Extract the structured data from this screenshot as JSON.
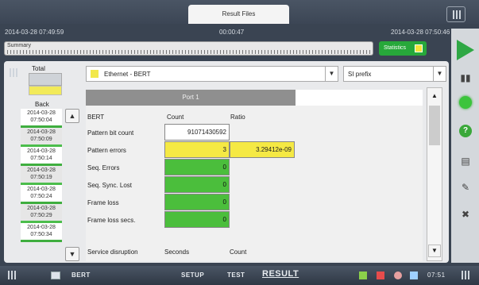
{
  "top": {
    "tab_label": "Result Files",
    "start_time": "2014-03-28 07:49:59",
    "elapsed": "00:00:47",
    "current_time": "2014-03-28 07:50:46"
  },
  "summary": {
    "label": "Summary",
    "statistics_label": "Statistics"
  },
  "left": {
    "total_label": "Total",
    "back_label": "Back",
    "history": [
      {
        "date": "2014-03-28",
        "time": "07:50:04"
      },
      {
        "date": "2014-03-28",
        "time": "07:50:09"
      },
      {
        "date": "2014-03-28",
        "time": "07:50:14"
      },
      {
        "date": "2014-03-28",
        "time": "07:50:19"
      },
      {
        "date": "2014-03-28",
        "time": "07:50:24"
      },
      {
        "date": "2014-03-28",
        "time": "07:50:29"
      },
      {
        "date": "2014-03-28",
        "time": "07:50:34"
      }
    ]
  },
  "selectors": {
    "test_type": "Ethernet - BERT",
    "prefix": "SI prefix"
  },
  "table": {
    "port_header": "Port 1",
    "section_title": "BERT",
    "col_count": "Count",
    "col_ratio": "Ratio",
    "rows": [
      {
        "label": "Pattern bit count",
        "count": "91071430592",
        "ratio": ""
      },
      {
        "label": "Pattern errors",
        "count": "3",
        "ratio": "3.29412e-09"
      },
      {
        "label": "Seq. Errors",
        "count": "0",
        "ratio": ""
      },
      {
        "label": "Seq. Sync. Lost",
        "count": "0",
        "ratio": ""
      },
      {
        "label": "Frame loss",
        "count": "0",
        "ratio": ""
      },
      {
        "label": "Frame loss secs.",
        "count": "0",
        "ratio": ""
      }
    ],
    "sd_title": "Service disruption",
    "sd_col_seconds": "Seconds",
    "sd_col_count": "Count"
  },
  "bottom": {
    "app_label": "BERT",
    "setup": "SETUP",
    "test": "TEST",
    "result": "RESULT",
    "clock": "07:51"
  },
  "colors": {
    "ok_green": "#4bbe3c",
    "alarm_yellow": "#f5e944",
    "header_gray": "#8f8f8f"
  }
}
